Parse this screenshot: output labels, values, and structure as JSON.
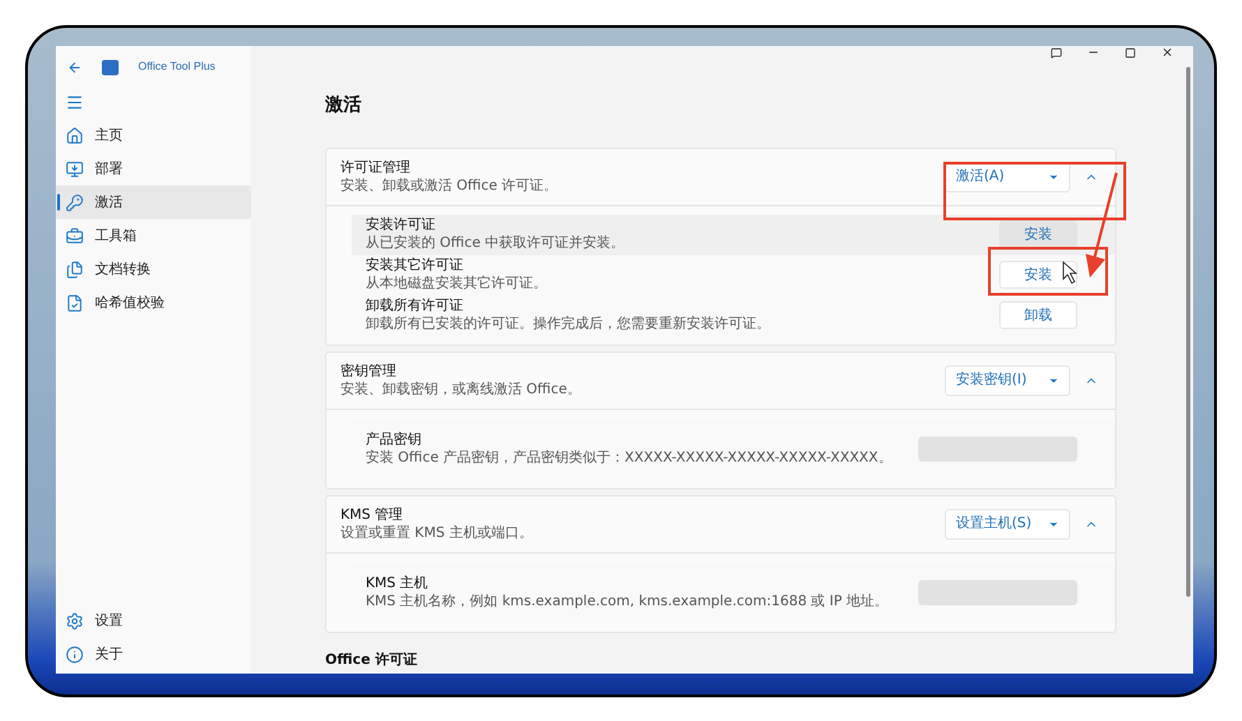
{
  "window": {
    "title": "Office Tool Plus"
  },
  "sidebar": {
    "items": [
      {
        "label": "主页",
        "selected": false
      },
      {
        "label": "部署",
        "selected": false
      },
      {
        "label": "激活",
        "selected": true
      },
      {
        "label": "工具箱",
        "selected": false
      },
      {
        "label": "文档转换",
        "selected": false
      },
      {
        "label": "哈希值校验",
        "selected": false
      }
    ],
    "footer_items": [
      {
        "label": "设置",
        "selected": false
      },
      {
        "label": "关于",
        "selected": false
      }
    ]
  },
  "page": {
    "title": "激活",
    "sections": [
      {
        "title": "许可证管理",
        "description": "安装、卸载或激活 Office 许可证。",
        "action": "激活(A)",
        "expanded": true,
        "rows": [
          {
            "kind": "button",
            "title": "安装许可证",
            "description": "从已安装的 Office 中获取许可证并安装。",
            "button": "安装",
            "highlighted": true
          },
          {
            "kind": "button",
            "title": "安装其它许可证",
            "description": "从本地磁盘安装其它许可证。",
            "button": "安装",
            "highlighted": false
          },
          {
            "kind": "button",
            "title": "卸载所有许可证",
            "description": "卸载所有已安装的许可证。操作完成后，您需要重新安装许可证。",
            "button": "卸载",
            "highlighted": false
          }
        ]
      },
      {
        "title": "密钥管理",
        "description": "安装、卸载密钥，或离线激活 Office。",
        "action": "安装密钥(I)",
        "expanded": true,
        "rows": [
          {
            "kind": "field",
            "title": "产品密钥",
            "description": "安装 Office 产品密钥，产品密钥类似于：XXXXX-XXXXX-XXXXX-XXXXX-XXXXX。",
            "highlighted": false
          }
        ]
      },
      {
        "title": "KMS 管理",
        "description": "设置或重置 KMS 主机或端口。",
        "action": "设置主机(S)",
        "expanded": true,
        "rows": [
          {
            "kind": "field",
            "title": "KMS 主机",
            "description": "KMS 主机名称，例如 kms.example.com, kms.example.com:1688 或 IP 地址。",
            "highlighted": false
          }
        ]
      }
    ],
    "subheading": "Office 许可证"
  }
}
